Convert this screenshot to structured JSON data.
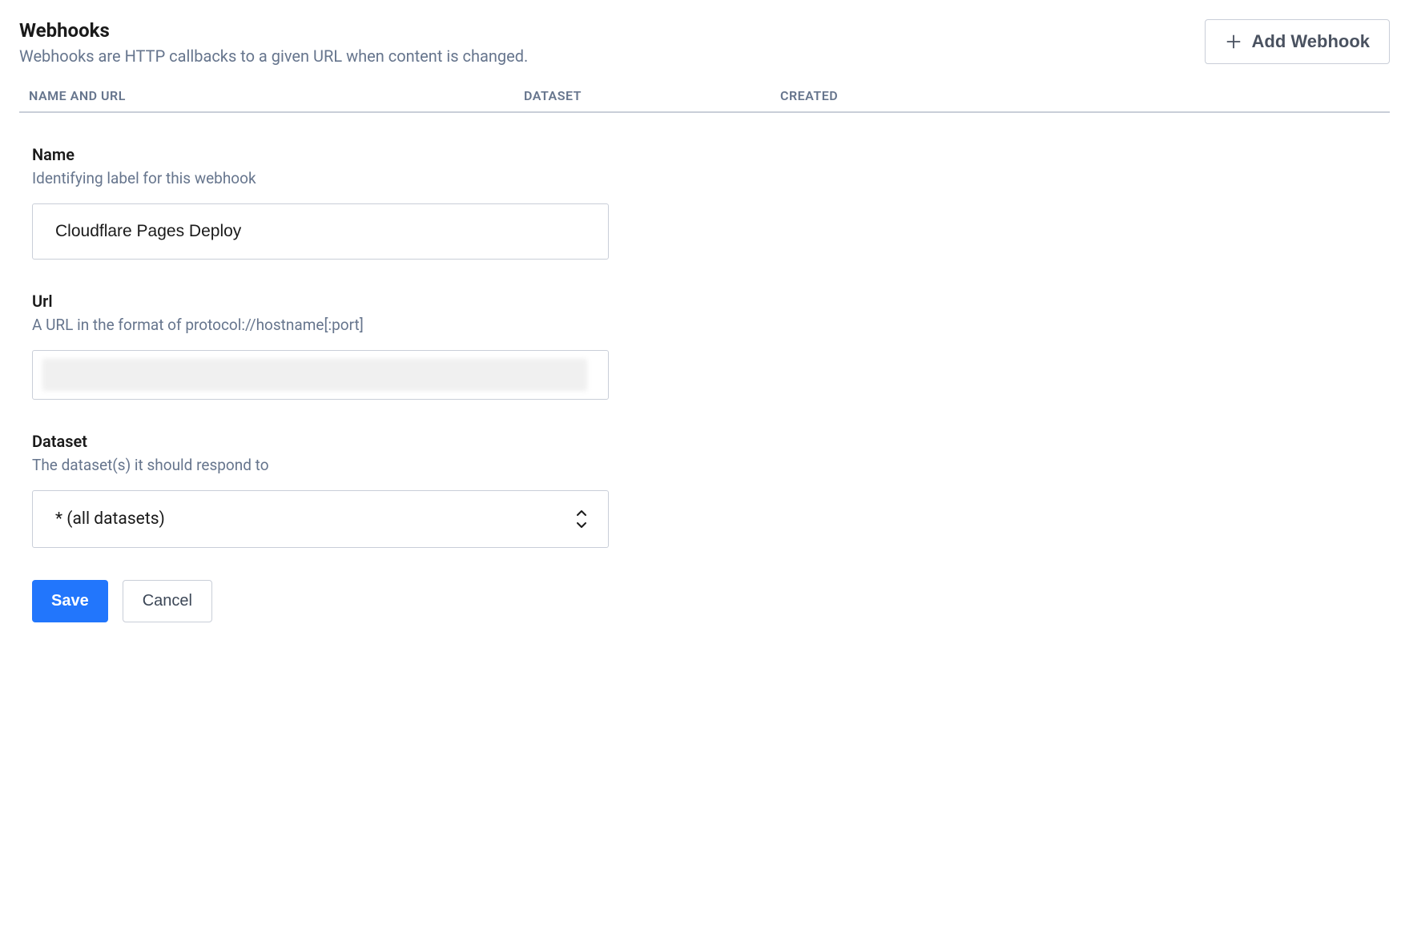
{
  "header": {
    "title": "Webhooks",
    "subtitle": "Webhooks are HTTP callbacks to a given URL when content is changed.",
    "add_button": "Add Webhook"
  },
  "table": {
    "col_name_url": "NAME AND URL",
    "col_dataset": "DATASET",
    "col_created": "CREATED"
  },
  "form": {
    "name": {
      "label": "Name",
      "description": "Identifying label for this webhook",
      "value": "Cloudflare Pages Deploy"
    },
    "url": {
      "label": "Url",
      "description": "A URL in the format of protocol://hostname[:port]",
      "value": ""
    },
    "dataset": {
      "label": "Dataset",
      "description": "The dataset(s) it should respond to",
      "selected": "* (all datasets)"
    },
    "save": "Save",
    "cancel": "Cancel"
  }
}
